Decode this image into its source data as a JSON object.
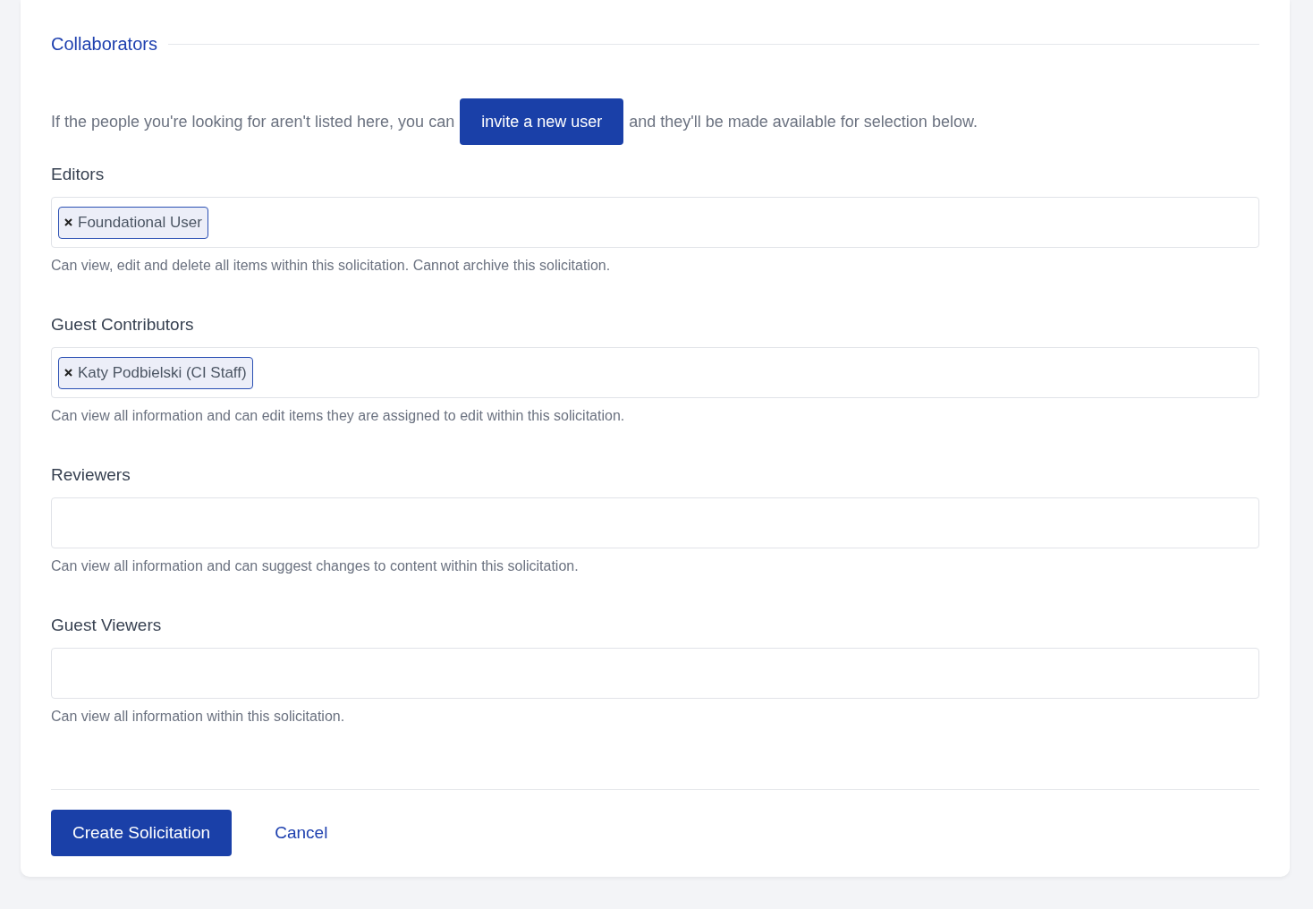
{
  "section": {
    "title": "Collaborators"
  },
  "intro": {
    "before": "If the people you're looking for aren't listed here, you can",
    "button": "invite a new user",
    "after": "and they'll be made available for selection below."
  },
  "fields": [
    {
      "label": "Editors",
      "tags": [
        "Foundational User"
      ],
      "help": "Can view, edit and delete all items within this solicitation. Cannot archive this solicitation."
    },
    {
      "label": "Guest Contributors",
      "tags": [
        "Katy Podbielski (CI Staff)"
      ],
      "help": "Can view all information and can edit items they are assigned to edit within this solicitation."
    },
    {
      "label": "Reviewers",
      "help": "Can view all information and can suggest changes to content within this solicitation."
    },
    {
      "label": "Guest Viewers",
      "help": "Can view all information within this solicitation."
    }
  ],
  "actions": {
    "primary": "Create Solicitation",
    "secondary": "Cancel"
  }
}
